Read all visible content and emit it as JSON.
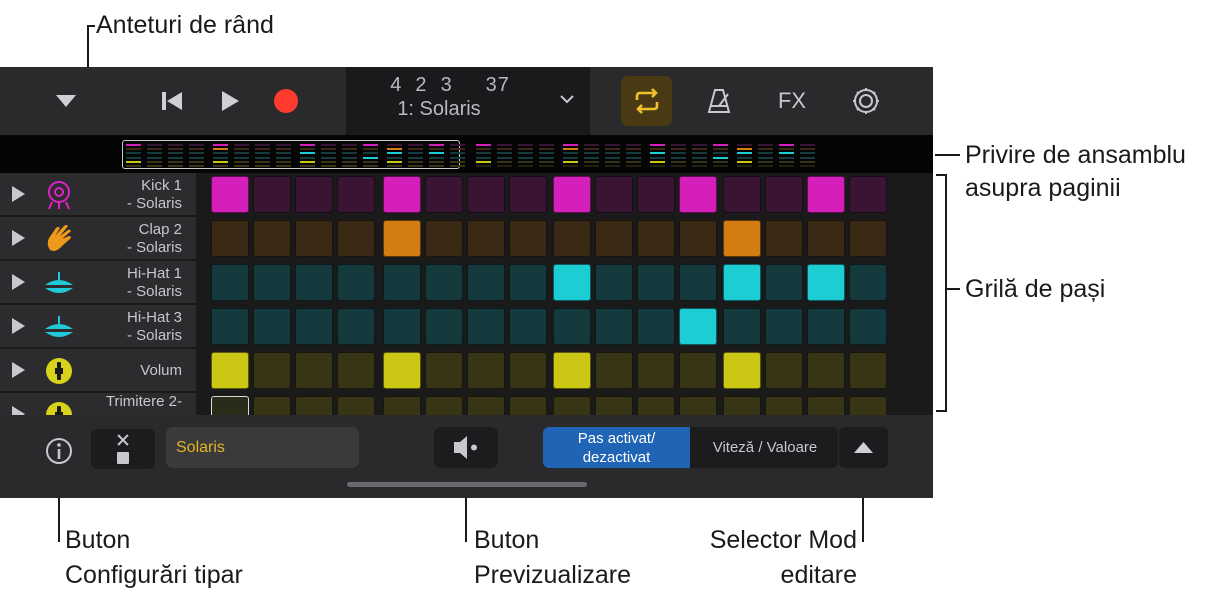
{
  "callouts": {
    "row_headers": "Anteturi de rând",
    "page_overview_1": "Privire de ansamblu",
    "page_overview_2": "asupra paginii",
    "step_grid": "Grilă de pași",
    "pattern_settings_1": "Buton",
    "pattern_settings_2": "Configurări tipar",
    "preview_1": "Buton",
    "preview_2": "Previzualizare",
    "edit_mode_1": "Selector Mod",
    "edit_mode_2": "editare"
  },
  "toolbar": {
    "position": "4  2  3     37",
    "pattern_name": "1: Solaris",
    "fx_label": "FX",
    "loop_color": "#f2c12e"
  },
  "rows": [
    {
      "name_line1": "Kick 1",
      "name_line2": "- Solaris",
      "icon": "kick-drum-icon",
      "icon_color": "#e020c8",
      "on_color": "#d41fba",
      "off_color": "#3a1533",
      "active": [
        0,
        4,
        8,
        11,
        14
      ]
    },
    {
      "name_line1": "Clap 2",
      "name_line2": "- Solaris",
      "icon": "clap-hand-icon",
      "icon_color": "#f09a1c",
      "on_color": "#d27c12",
      "off_color": "#3a2a15",
      "active": [
        4,
        12
      ]
    },
    {
      "name_line1": "Hi-Hat 1",
      "name_line2": "- Solaris",
      "icon": "hihat-icon",
      "icon_color": "#22c8d8",
      "on_color": "#1ccdd4",
      "off_color": "#143a3d",
      "active": [
        8,
        12,
        14
      ]
    },
    {
      "name_line1": "Hi-Hat 3",
      "name_line2": "- Solaris",
      "icon": "hihat-icon",
      "icon_color": "#22c8d8",
      "on_color": "#1ccdd4",
      "off_color": "#143a3d",
      "active": [
        11
      ]
    },
    {
      "name_line1": "Volum",
      "name_line2": "",
      "icon": "volume-knob-icon",
      "icon_color": "#d8d21a",
      "on_color": "#ccc714",
      "off_color": "#373515",
      "active": [
        0,
        4,
        8,
        12
      ]
    },
    {
      "name_line1": "Trimitere 2-",
      "name_line2": "",
      "icon": "send-knob-icon",
      "icon_color": "#d8d21a",
      "on_color": "#ccc714",
      "off_color": "#373515",
      "active": []
    }
  ],
  "bottom": {
    "pattern_name_field": "Solaris",
    "mode_step_on_off": "Pas activat/ dezactivat",
    "mode_velocity": "Viteză / Valoare"
  }
}
